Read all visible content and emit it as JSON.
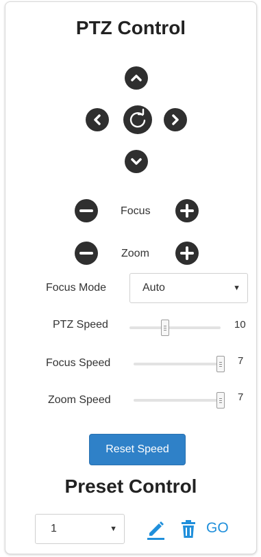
{
  "ptz": {
    "title": "PTZ Control",
    "focus_label": "Focus",
    "zoom_label": "Zoom"
  },
  "focus_mode": {
    "label": "Focus Mode",
    "value": "Auto"
  },
  "sliders": {
    "ptz": {
      "label": "PTZ Speed",
      "value": "10",
      "level": 0.38
    },
    "focus": {
      "label": "Focus Speed",
      "value": "7",
      "level": 1.0
    },
    "zoom": {
      "label": "Zoom Speed",
      "value": "7",
      "level": 1.0
    }
  },
  "reset_button": "Reset Speed",
  "preset": {
    "title": "Preset Control",
    "selected": "1",
    "go_label": "GO"
  },
  "colors": {
    "accent": "#1f8fdb",
    "button": "#2f81c8",
    "control": "#2f2f2f"
  },
  "icons": [
    "chevron-up-icon",
    "chevron-left-icon",
    "refresh-icon",
    "chevron-right-icon",
    "chevron-down-icon",
    "minus-icon",
    "plus-icon",
    "pencil-icon",
    "trash-icon"
  ]
}
